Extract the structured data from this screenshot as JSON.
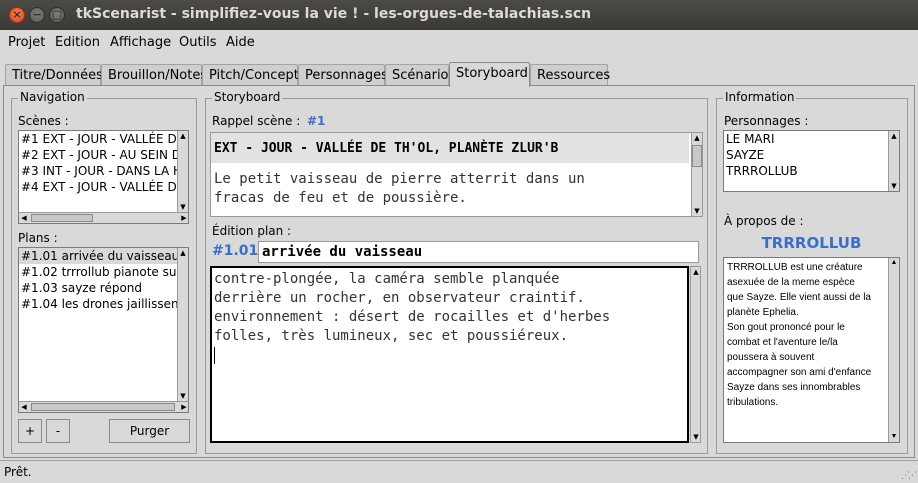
{
  "window": {
    "title": "tkScenarist - simplifiez-vous la vie ! - les-orgues-de-talachias.scn",
    "close_glyph": "×",
    "minimize_glyph": "−",
    "maximize_glyph": "□"
  },
  "menu": [
    "Projet",
    "Edition",
    "Affichage",
    "Outils",
    "Aide"
  ],
  "tabs": [
    "Titre/Données",
    "Brouillon/Notes",
    "Pitch/Concept",
    "Personnages",
    "Scénario",
    "Storyboard",
    "Ressources"
  ],
  "active_tab": "Storyboard",
  "navigation": {
    "title": "Navigation",
    "scenes_label": "Scènes :",
    "scenes": [
      "#1 EXT - JOUR - VALLÉE D",
      "#2 EXT - JOUR - AU SEIN D",
      "#3 INT - JOUR - DANS LA H",
      "#4 EXT - JOUR - VALLÉE D"
    ],
    "plans_label": "Plans :",
    "plans": [
      "#1.01 arrivée du vaisseau",
      "#1.02 trrrollub pianote su",
      "#1.03 sayze répond",
      "#1.04 les drones jaillissen"
    ],
    "selected_plan": "#1.01 arrivée du vaisseau",
    "add_label": "+",
    "remove_label": "-",
    "purge_label": "Purger"
  },
  "storyboard": {
    "title": "Storyboard",
    "rappel_label": "Rappel scène :",
    "scene_number": "#1",
    "scene_heading": "EXT - JOUR - VALLÉE DE TH'OL, PLANÈTE ZLUR'B",
    "scene_text_lines": [
      "Le petit vaisseau de pierre atterrit dans un",
      "fracas de feu et de poussière."
    ],
    "edition_label": "Édition plan :",
    "plan_number": "#1.01",
    "plan_title": "arrivée du vaisseau",
    "plan_text_lines": [
      "contre-plongée, la caméra semble planquée",
      "derrière un rocher, en observateur craintif.",
      "environnement : désert de rocailles et d'herbes",
      "folles, très lumineux, sec et poussiéreux."
    ]
  },
  "information": {
    "title": "Information",
    "characters_label": "Personnages :",
    "characters": [
      "LE MARI",
      "SAYZE",
      "TRRROLLUB"
    ],
    "about_label": "À propos de :",
    "about_name": "TRRROLLUB",
    "about_lines": [
      "TRRROLLUB est une créature",
      "asexuée de la meme espèce",
      "que Sayze. Elle vient aussi de la",
      "planète Ephelia.",
      "Son gout prononcé pour le",
      "combat et l'aventure le/la",
      "poussera à souvent",
      "accompagner son ami d'enfance",
      "Sayze dans ses innombrables",
      "tribulations."
    ]
  },
  "status": "Prêt.",
  "colors": {
    "accent_blue": "#3c6ec8",
    "titlebar": "#3b3a36",
    "window_bg": "#d9d9d9"
  }
}
